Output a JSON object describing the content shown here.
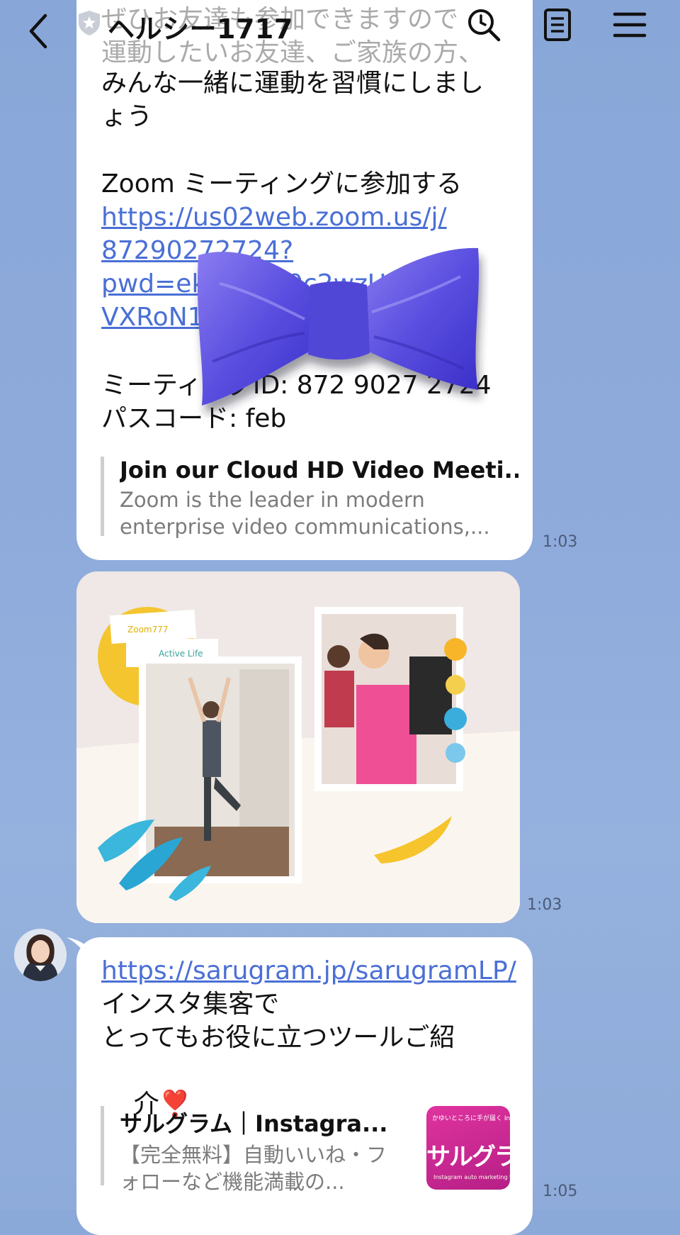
{
  "header": {
    "back_icon": "chevron-left-icon",
    "verified_icon": "shield-icon",
    "title": "ヘルシー1717",
    "search_icon": "search-icon",
    "notes_icon": "notes-icon",
    "menu_icon": "hamburger-menu-icon"
  },
  "messages": {
    "zoom": {
      "partial_top": "ぜひお友達も参加できますので\n運動したいお友達、ご家族の方、",
      "text_intro": "みんな一緒に運動を習慣にしましょう",
      "join_label": "Zoom ミーティングに参加する",
      "link": "https://us02web.zoom.us/j/87290272724?pwd=ekVxb3o0c2wzUmlvdsVXRoN1",
      "link_lines": [
        "https://us02web.zoom.us/j/",
        "87290272724?",
        "pwd=ekVxb3o0c2wzUmlvds",
        "VXRoN1"
      ],
      "meeting_id_line": "ミーティングID: 872 9027 2724",
      "passcode_line": "パスコード: feb",
      "preview_title": "Join our Cloud HD Video Meeti...",
      "preview_desc": "Zoom is the leader in modern\nenterprise video communications,...",
      "time": "1:03"
    },
    "image": {
      "time": "1:03",
      "label_1": "Zoom777",
      "label_2": "Active Life"
    },
    "sarugram": {
      "link": "https://sarugram.jp/sarugramLP/",
      "line_1": "インスタ集客で",
      "line_2": "とってもお役に立つツールご紹",
      "line_3": "介",
      "emoji": "❣️",
      "preview_title": "サルグラム｜Instagra...",
      "preview_desc": "【完全無料】自動いいね・フ\nォローなど機能満載の...",
      "thumb_top": "かゆいところに手が届く Instagram 自動集客ツールの決定版",
      "thumb_main": "サルグラム",
      "thumb_bottom": "Instagram auto marketing tool",
      "time": "1:05"
    }
  },
  "colors": {
    "background": "#8aa8d8",
    "link": "#4a6fd6",
    "bubble": "#ffffff"
  }
}
